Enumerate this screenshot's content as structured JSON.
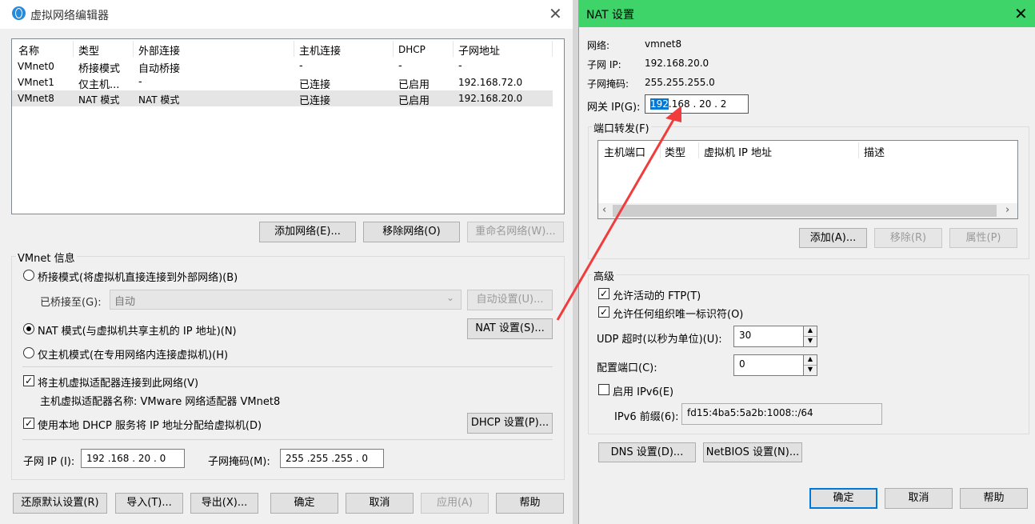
{
  "left_window": {
    "title": "虚拟网络编辑器",
    "columns": [
      "名称",
      "类型",
      "外部连接",
      "主机连接",
      "DHCP",
      "子网地址"
    ],
    "rows": [
      [
        "VMnet0",
        "桥接模式",
        "自动桥接",
        "-",
        "-",
        "-"
      ],
      [
        "VMnet1",
        "仅主机...",
        "-",
        "已连接",
        "已启用",
        "192.168.72.0"
      ],
      [
        "VMnet8",
        "NAT 模式",
        "NAT 模式",
        "已连接",
        "已启用",
        "192.168.20.0"
      ]
    ],
    "add_network_button": "添加网络(E)...",
    "remove_network_button": "移除网络(O)",
    "rename_network_button": "重命名网络(W)...",
    "vmnet_info_title": "VMnet 信息",
    "bridge_mode_label": "桥接模式(将虚拟机直接连接到外部网络)(B)",
    "bridged_to_label": "已桥接至(G):",
    "bridged_to_value": "自动",
    "auto_settings_button": "自动设置(U)...",
    "nat_mode_label": "NAT 模式(与虚拟机共享主机的 IP 地址)(N)",
    "nat_settings_button": "NAT 设置(S)...",
    "host_only_label": "仅主机模式(在专用网络内连接虚拟机)(H)",
    "connect_adapter_label": "将主机虚拟适配器连接到此网络(V)",
    "adapter_name_text": "主机虚拟适配器名称: VMware 网络适配器 VMnet8",
    "use_dhcp_label": "使用本地 DHCP 服务将 IP 地址分配给虚拟机(D)",
    "dhcp_settings_button": "DHCP 设置(P)...",
    "subnet_ip_label": "子网 IP (I):",
    "subnet_ip_value": "192 .168 . 20 .  0",
    "subnet_mask_label": "子网掩码(M):",
    "subnet_mask_value": "255 .255 .255 .  0",
    "restore_defaults_button": "还原默认设置(R)",
    "import_button": "导入(T)...",
    "export_button": "导出(X)...",
    "ok_button": "确定",
    "cancel_button": "取消",
    "apply_button": "应用(A)",
    "help_button": "帮助"
  },
  "nat_window": {
    "title": "NAT 设置",
    "network_label": "网络:",
    "network_value": "vmnet8",
    "subnet_ip_label": "子网 IP:",
    "subnet_ip_value": "192.168.20.0",
    "subnet_mask_label": "子网掩码:",
    "subnet_mask_value": "255.255.255.0",
    "gateway_label": "网关 IP(G):",
    "gateway_octet_selected": "192",
    "gateway_rest": ".168 . 20 .  2",
    "port_forward_title": "端口转发(F)",
    "port_columns": [
      "主机端口",
      "类型",
      "虚拟机 IP 地址",
      "描述"
    ],
    "add_button": "添加(A)...",
    "remove_button": "移除(R)",
    "properties_button": "属性(P)",
    "advanced_title": "高级",
    "allow_ftp_label": "允许活动的 FTP(T)",
    "allow_uuid_label": "允许任何组织唯一标识符(O)",
    "udp_timeout_label": "UDP 超时(以秒为单位)(U):",
    "udp_timeout_value": "30",
    "config_port_label": "配置端口(C):",
    "config_port_value": "0",
    "enable_ipv6_label": "启用 IPv6(E)",
    "ipv6_prefix_label": "IPv6 前缀(6):",
    "ipv6_prefix_value": "fd15:4ba5:5a2b:1008::/64",
    "dns_button": "DNS 设置(D)...",
    "netbios_button": "NetBIOS 设置(N)...",
    "ok_button": "确定",
    "cancel_button": "取消",
    "help_button": "帮助"
  },
  "colors": {
    "nat_titlebar": "#3ed46a",
    "annotation_arrow": "#f03c3c",
    "selection": "#0078d7"
  }
}
